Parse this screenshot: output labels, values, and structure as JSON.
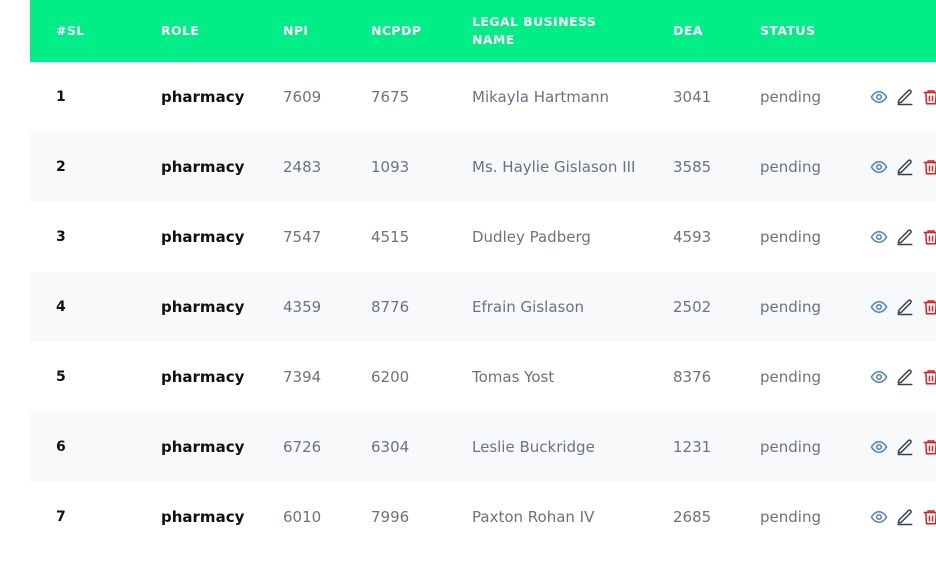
{
  "table": {
    "headers": [
      "#SL",
      "ROLE",
      "NPI",
      "NCPDP",
      "LEGAL BUSINESS\nNAME",
      "DEA",
      "STATUS",
      ""
    ],
    "rows": [
      {
        "sl": "1",
        "role": "pharmacy",
        "npi": "7609",
        "ncpdp": "7675",
        "name": "Mikayla Hartmann",
        "dea": "3041",
        "status": "pending"
      },
      {
        "sl": "2",
        "role": "pharmacy",
        "npi": "2483",
        "ncpdp": "1093",
        "name": "Ms. Haylie Gislason III",
        "dea": "3585",
        "status": "pending"
      },
      {
        "sl": "3",
        "role": "pharmacy",
        "npi": "7547",
        "ncpdp": "4515",
        "name": "Dudley Padberg",
        "dea": "4593",
        "status": "pending"
      },
      {
        "sl": "4",
        "role": "pharmacy",
        "npi": "4359",
        "ncpdp": "8776",
        "name": "Efrain Gislason",
        "dea": "2502",
        "status": "pending"
      },
      {
        "sl": "5",
        "role": "pharmacy",
        "npi": "7394",
        "ncpdp": "6200",
        "name": "Tomas Yost",
        "dea": "8376",
        "status": "pending"
      },
      {
        "sl": "6",
        "role": "pharmacy",
        "npi": "6726",
        "ncpdp": "6304",
        "name": "Leslie Buckridge",
        "dea": "1231",
        "status": "pending"
      },
      {
        "sl": "7",
        "role": "pharmacy",
        "npi": "6010",
        "ncpdp": "7996",
        "name": "Paxton Rohan IV",
        "dea": "2685",
        "status": "pending"
      }
    ]
  },
  "icons": {
    "view": "eye-icon",
    "edit": "pencil-icon",
    "delete": "trash-icon"
  },
  "colors": {
    "header_bg": "#00ee85",
    "view": "#4a7fd6",
    "edit": "#374151",
    "delete": "#e11d1d"
  }
}
